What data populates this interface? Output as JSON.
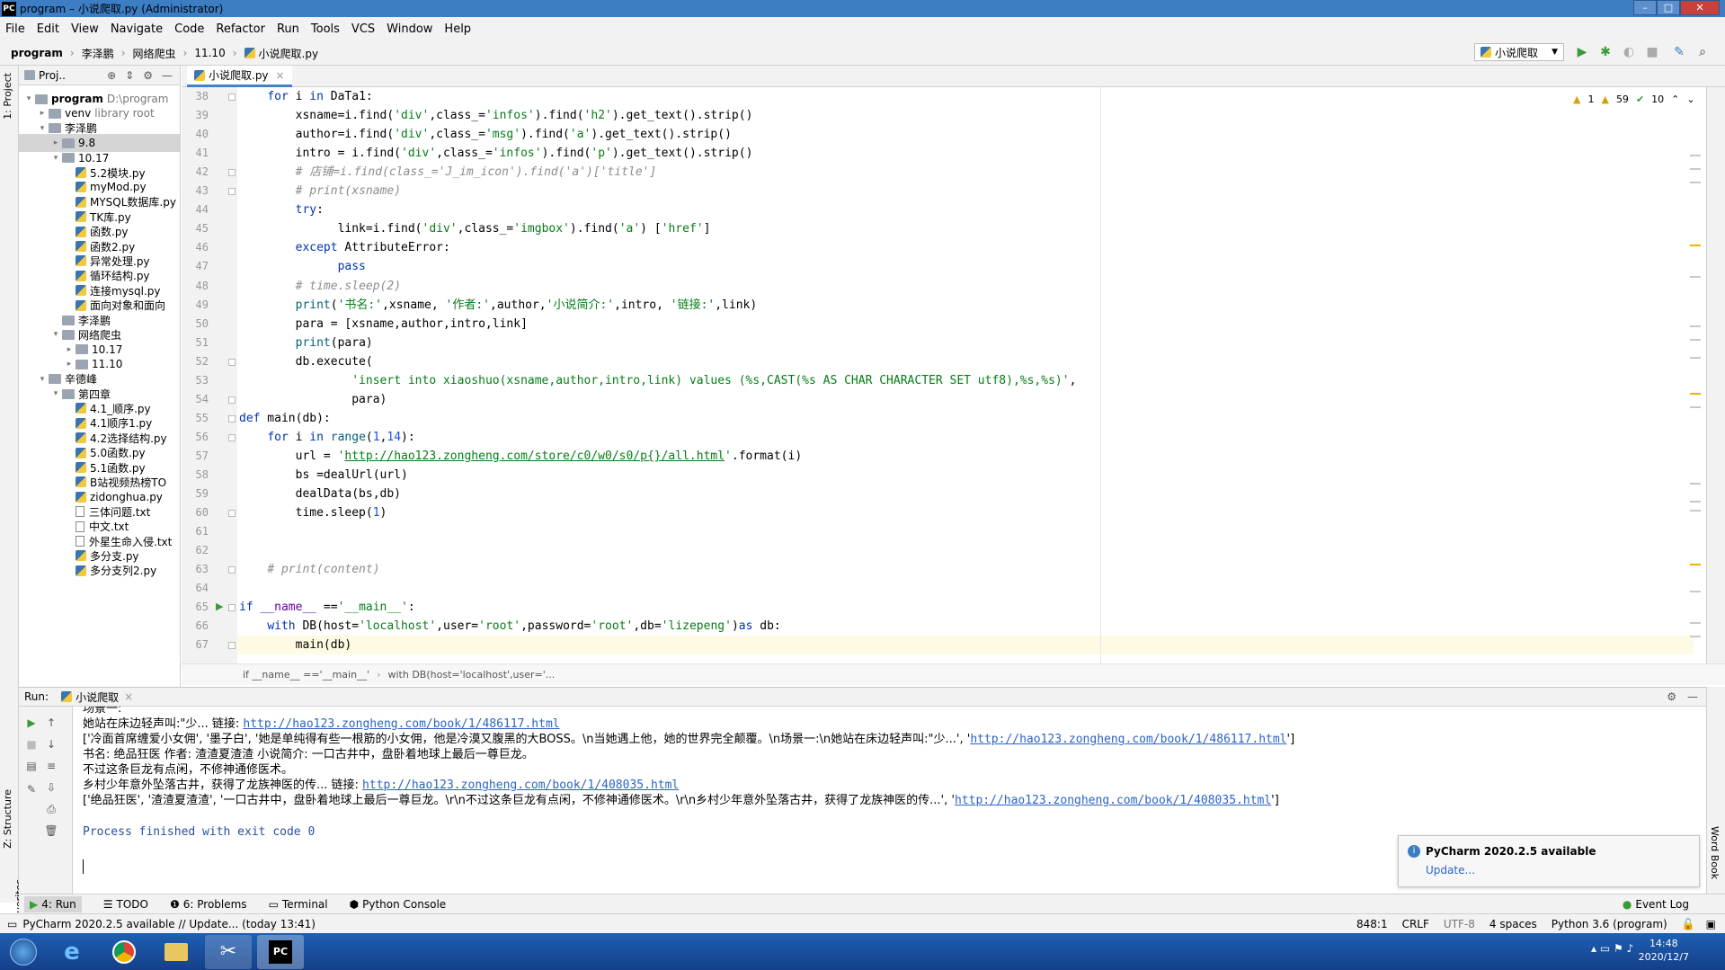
{
  "window": {
    "title": "program – 小说爬取.py (Administrator)",
    "logo": "PC"
  },
  "menu": [
    "File",
    "Edit",
    "View",
    "Navigate",
    "Code",
    "Refactor",
    "Run",
    "Tools",
    "VCS",
    "Window",
    "Help"
  ],
  "breadcrumbs": [
    "program",
    "李泽鹏",
    "网络爬虫",
    "11.10",
    "小说爬取.py"
  ],
  "run_config": "小说爬取",
  "project": {
    "header": "Proj..",
    "items": [
      {
        "label": "program",
        "note": "D:\\program",
        "depth": 0,
        "arrow": "▾",
        "kind": "folder",
        "bold": true
      },
      {
        "label": "venv",
        "note": "library root",
        "depth": 1,
        "arrow": "▸",
        "kind": "folder"
      },
      {
        "label": "李泽鹏",
        "note": "",
        "depth": 1,
        "arrow": "▾",
        "kind": "folder"
      },
      {
        "label": "9.8",
        "note": "",
        "depth": 2,
        "arrow": "▸",
        "kind": "folder",
        "selected": true
      },
      {
        "label": "10.17",
        "note": "",
        "depth": 2,
        "arrow": "▾",
        "kind": "folder"
      },
      {
        "label": "5.2模块.py",
        "note": "",
        "depth": 3,
        "arrow": "",
        "kind": "py"
      },
      {
        "label": "myMod.py",
        "note": "",
        "depth": 3,
        "arrow": "",
        "kind": "py"
      },
      {
        "label": "MYSQL数据库.py",
        "note": "",
        "depth": 3,
        "arrow": "",
        "kind": "py"
      },
      {
        "label": "TK库.py",
        "note": "",
        "depth": 3,
        "arrow": "",
        "kind": "py"
      },
      {
        "label": "函数.py",
        "note": "",
        "depth": 3,
        "arrow": "",
        "kind": "py"
      },
      {
        "label": "函数2.py",
        "note": "",
        "depth": 3,
        "arrow": "",
        "kind": "py"
      },
      {
        "label": "异常处理.py",
        "note": "",
        "depth": 3,
        "arrow": "",
        "kind": "py"
      },
      {
        "label": "循环结构.py",
        "note": "",
        "depth": 3,
        "arrow": "",
        "kind": "py"
      },
      {
        "label": "连接mysql.py",
        "note": "",
        "depth": 3,
        "arrow": "",
        "kind": "py"
      },
      {
        "label": "面向对象和面向",
        "note": "",
        "depth": 3,
        "arrow": "",
        "kind": "py"
      },
      {
        "label": "李泽鹏",
        "note": "",
        "depth": 2,
        "arrow": "",
        "kind": "folder"
      },
      {
        "label": "网络爬虫",
        "note": "",
        "depth": 2,
        "arrow": "▾",
        "kind": "folder"
      },
      {
        "label": "10.17",
        "note": "",
        "depth": 3,
        "arrow": "▸",
        "kind": "folder"
      },
      {
        "label": "11.10",
        "note": "",
        "depth": 3,
        "arrow": "▸",
        "kind": "folder"
      },
      {
        "label": "辛德峰",
        "note": "",
        "depth": 1,
        "arrow": "▾",
        "kind": "folder"
      },
      {
        "label": "第四章",
        "note": "",
        "depth": 2,
        "arrow": "▾",
        "kind": "folder"
      },
      {
        "label": "4.1_顺序.py",
        "note": "",
        "depth": 3,
        "arrow": "",
        "kind": "py"
      },
      {
        "label": "4.1顺序1.py",
        "note": "",
        "depth": 3,
        "arrow": "",
        "kind": "py"
      },
      {
        "label": "4.2选择结构.py",
        "note": "",
        "depth": 3,
        "arrow": "",
        "kind": "py"
      },
      {
        "label": "5.0函数.py",
        "note": "",
        "depth": 3,
        "arrow": "",
        "kind": "py"
      },
      {
        "label": "5.1函数.py",
        "note": "",
        "depth": 3,
        "arrow": "",
        "kind": "py"
      },
      {
        "label": "B站视频热榜TO",
        "note": "",
        "depth": 3,
        "arrow": "",
        "kind": "py"
      },
      {
        "label": "zidonghua.py",
        "note": "",
        "depth": 3,
        "arrow": "",
        "kind": "py"
      },
      {
        "label": "三体问题.txt",
        "note": "",
        "depth": 3,
        "arrow": "",
        "kind": "txt"
      },
      {
        "label": "中文.txt",
        "note": "",
        "depth": 3,
        "arrow": "",
        "kind": "txt"
      },
      {
        "label": "外星生命入侵.txt",
        "note": "",
        "depth": 3,
        "arrow": "",
        "kind": "txt"
      },
      {
        "label": "多分支.py",
        "note": "",
        "depth": 3,
        "arrow": "",
        "kind": "py"
      },
      {
        "label": "多分支列2.py",
        "note": "",
        "depth": 3,
        "arrow": "",
        "kind": "py"
      }
    ]
  },
  "editor": {
    "tab": "小说爬取.py",
    "inspections": {
      "errors": "1",
      "warnings": "59",
      "ok": "10"
    },
    "lines": [
      {
        "n": "38",
        "code": "    for i in DaTa1:"
      },
      {
        "n": "39",
        "code": "        xsname=i.find('div',class_='infos').find('h2').get_text().strip()"
      },
      {
        "n": "40",
        "code": "        author=i.find('div',class_='msg').find('a').get_text().strip()"
      },
      {
        "n": "41",
        "code": "        intro = i.find('div',class_='infos').find('p').get_text().strip()"
      },
      {
        "n": "42",
        "code": "        # 店铺=i.find(class_='J_im_icon').find('a')['title']"
      },
      {
        "n": "43",
        "code": "        # print(xsname)"
      },
      {
        "n": "44",
        "code": "        try:"
      },
      {
        "n": "45",
        "code": "              link=i.find('div',class_='imgbox').find('a') ['href']"
      },
      {
        "n": "46",
        "code": "        except AttributeError:"
      },
      {
        "n": "47",
        "code": "              pass"
      },
      {
        "n": "48",
        "code": "        # time.sleep(2)"
      },
      {
        "n": "49",
        "code": "        print('书名:',xsname, '作者:',author,'小说简介:',intro, '链接:',link)"
      },
      {
        "n": "50",
        "code": "        para = [xsname,author,intro,link]"
      },
      {
        "n": "51",
        "code": "        print(para)"
      },
      {
        "n": "52",
        "code": "        db.execute("
      },
      {
        "n": "53",
        "code": "                'insert into xiaoshuo(xsname,author,intro,link) values (%s,CAST(%s AS CHAR CHARACTER SET utf8),%s,%s)',"
      },
      {
        "n": "54",
        "code": "                para)"
      },
      {
        "n": "55",
        "code": "def main(db):"
      },
      {
        "n": "56",
        "code": "    for i in range(1,14):"
      },
      {
        "n": "57",
        "code": "        url = 'http://hao123.zongheng.com/store/c0/w0/s0/p{}/all.html'.format(i)"
      },
      {
        "n": "58",
        "code": "        bs =dealUrl(url)"
      },
      {
        "n": "59",
        "code": "        dealData(bs,db)"
      },
      {
        "n": "60",
        "code": "        time.sleep(1)"
      },
      {
        "n": "61",
        "code": ""
      },
      {
        "n": "62",
        "code": ""
      },
      {
        "n": "63",
        "code": "    # print(content)"
      },
      {
        "n": "64",
        "code": ""
      },
      {
        "n": "65",
        "code": "if __name__ =='__main__':"
      },
      {
        "n": "66",
        "code": "    with DB(host='localhost',user='root',password='root',db='lizepeng')as db:"
      },
      {
        "n": "67",
        "code": "        main(db)"
      }
    ],
    "breadcrumb": [
      "if __name__ =='__main__'",
      "with DB(host='localhost',user='..."
    ]
  },
  "run": {
    "label": "Run:",
    "tab": "小说爬取",
    "lines": [
      {
        "text": "场景一:",
        "link": "",
        "tail": ""
      },
      {
        "text": "她站在床边轻声叫:\"少... 链接: ",
        "link": "http://hao123.zongheng.com/book/1/486117.html",
        "tail": ""
      },
      {
        "text": "['冷面首席缠爱小女佣', '墨子白', '她是单纯得有些一根筋的小女佣，他是冷漠又腹黑的大BOSS。\\n当她遇上他，她的世界完全颠覆。\\n场景一:\\n她站在床边轻声叫:\"少...', '",
        "link": "http://hao123.zongheng.com/book/1/486117.html",
        "tail": "']"
      },
      {
        "text": "书名: 绝品狂医 作者: 渣渣夏渣渣 小说简介: 一口古井中，盘卧着地球上最后一尊巨龙。",
        "link": "",
        "tail": ""
      },
      {
        "text": "不过这条巨龙有点闲，不修神通修医术。",
        "link": "",
        "tail": ""
      },
      {
        "text": "乡村少年意外坠落古井，获得了龙族神医的传... 链接: ",
        "link": "http://hao123.zongheng.com/book/1/408035.html",
        "tail": ""
      },
      {
        "text": "['绝品狂医', '渣渣夏渣渣', '一口古井中，盘卧着地球上最后一尊巨龙。\\r\\n不过这条巨龙有点闲，不修神通修医术。\\r\\n乡村少年意外坠落古井，获得了龙族神医的传...', '",
        "link": "http://hao123.zongheng.com/book/1/408035.html",
        "tail": "']"
      },
      {
        "text": "",
        "link": "",
        "tail": ""
      },
      {
        "text": "Process finished with exit code 0",
        "link": "",
        "tail": ""
      }
    ]
  },
  "notification": {
    "title": "PyCharm 2020.2.5 available",
    "link": "Update..."
  },
  "tool_tabs": {
    "run": "4: Run",
    "todo": "TODO",
    "problems": "6: Problems",
    "terminal": "Terminal",
    "console": "Python Console",
    "event_log": "Event Log"
  },
  "side_tabs": {
    "project": "1: Project",
    "structure": "Z: Structure",
    "favorites": "2: Favorites",
    "wordbook": "Word Book"
  },
  "status": {
    "message": "PyCharm 2020.2.5 available // Update... (today 13:41)",
    "position": "848:1",
    "line_sep": "CRLF",
    "encoding": "UTF-8",
    "indent": "4 spaces",
    "interpreter": "Python 3.6 (program)"
  },
  "taskbar": {
    "time": "14:48",
    "date": "2020/12/7"
  },
  "colors": {
    "keyword": "#0033b3",
    "string": "#067d17",
    "comment": "#8c8c8c",
    "link": "#2a63c6",
    "titlebar": "#3c7dc4"
  }
}
